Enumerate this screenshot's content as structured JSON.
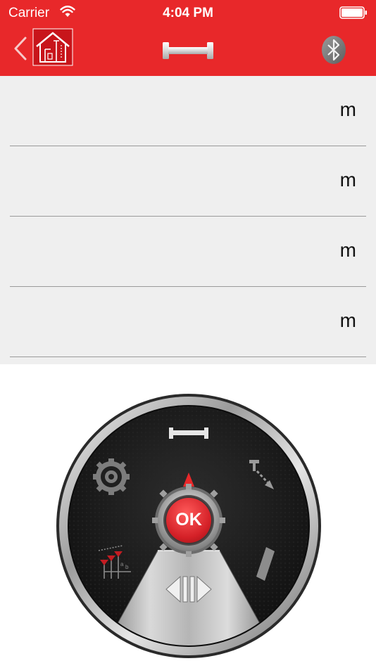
{
  "status_bar": {
    "carrier": "Carrier",
    "time": "4:04 PM"
  },
  "nav": {
    "back_icon": "chevron-left-icon",
    "logo_icon": "room-measure-icon",
    "mode_icon": "distance-measure-icon",
    "bluetooth_icon": "bluetooth-icon"
  },
  "measurements": [
    {
      "value": "",
      "unit": "m"
    },
    {
      "value": "",
      "unit": "m"
    },
    {
      "value": "",
      "unit": "m"
    },
    {
      "value": "",
      "unit": "m"
    }
  ],
  "dial": {
    "ok_label": "OK",
    "modes": [
      {
        "name": "distance",
        "icon": "distance-measure-icon"
      },
      {
        "name": "continuous",
        "icon": "continuous-measure-icon"
      },
      {
        "name": "area",
        "icon": "area-measure-icon"
      },
      {
        "name": "stakeout",
        "icon": "stakeout-icon"
      },
      {
        "name": "settings",
        "icon": "gear-icon"
      }
    ],
    "reference_icon": "reference-point-icon"
  },
  "colors": {
    "brand_red": "#e8282a",
    "list_background": "#efefef",
    "divider": "#9a9a9a",
    "dial_face": "#1c1c1c",
    "ok_button": "#d42027"
  }
}
